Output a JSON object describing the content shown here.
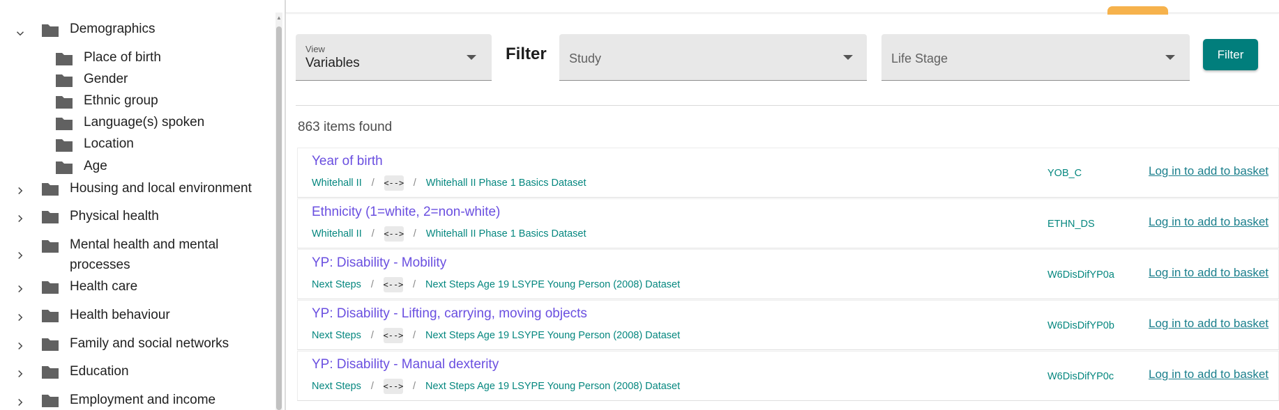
{
  "sidebar": {
    "items": [
      {
        "label": "Demographics",
        "expanded": true,
        "level": 0
      },
      {
        "label": "Place of birth",
        "level": 1
      },
      {
        "label": "Gender",
        "level": 1
      },
      {
        "label": "Ethnic group",
        "level": 1
      },
      {
        "label": "Language(s) spoken",
        "level": 1
      },
      {
        "label": "Location",
        "level": 1
      },
      {
        "label": "Age",
        "level": 1
      },
      {
        "label": "Housing and local environment",
        "expanded": false,
        "level": 0
      },
      {
        "label": "Physical health",
        "expanded": false,
        "level": 0
      },
      {
        "label": "Mental health and mental processes",
        "expanded": false,
        "level": 0
      },
      {
        "label": "Health care",
        "expanded": false,
        "level": 0
      },
      {
        "label": "Health behaviour",
        "expanded": false,
        "level": 0
      },
      {
        "label": "Family and social networks",
        "expanded": false,
        "level": 0
      },
      {
        "label": "Education",
        "expanded": false,
        "level": 0
      },
      {
        "label": "Employment and income",
        "expanded": false,
        "level": 0
      }
    ]
  },
  "controls": {
    "view_label": "View",
    "view_value": "Variables",
    "filter_title": "Filter",
    "study_placeholder": "Study",
    "life_stage_placeholder": "Life Stage",
    "filter_button": "Filter"
  },
  "results": {
    "count_text": "863 items found",
    "items": [
      {
        "title": "Year of birth",
        "study": "Whitehall II",
        "chip": "<-->",
        "dataset": "Whitehall II Phase 1 Basics Dataset",
        "code": "YOB_C",
        "basket": "Log in to add to basket"
      },
      {
        "title": "Ethnicity (1=white, 2=non-white)",
        "study": "Whitehall II",
        "chip": "<-->",
        "dataset": "Whitehall II Phase 1 Basics Dataset",
        "code": "ETHN_DS",
        "basket": "Log in to add to basket"
      },
      {
        "title": "YP: Disability - Mobility",
        "study": "Next Steps",
        "chip": "<-->",
        "dataset": "Next Steps Age 19 LSYPE Young Person (2008) Dataset",
        "code": "W6DisDifYP0a",
        "basket": "Log in to add to basket"
      },
      {
        "title": "YP: Disability - Lifting, carrying, moving objects",
        "study": "Next Steps",
        "chip": "<-->",
        "dataset": "Next Steps Age 19 LSYPE Young Person (2008) Dataset",
        "code": "W6DisDifYP0b",
        "basket": "Log in to add to basket"
      },
      {
        "title": "YP: Disability - Manual dexterity",
        "study": "Next Steps",
        "chip": "<-->",
        "dataset": "Next Steps Age 19 LSYPE Young Person (2008) Dataset",
        "code": "W6DisDifYP0c",
        "basket": "Log in to add to basket"
      }
    ]
  },
  "icons": {
    "folder": "folder-icon",
    "chevron_expanded": "chevron-down-icon",
    "chevron_collapsed": "chevron-right-icon",
    "dropdown": "caret-down-icon"
  },
  "colors": {
    "accent": "#017e7c",
    "link_purple": "#6a4fe0",
    "meta_teal": "#05877f",
    "folder_gray": "#616161",
    "orange_tab": "#f6b24c"
  }
}
